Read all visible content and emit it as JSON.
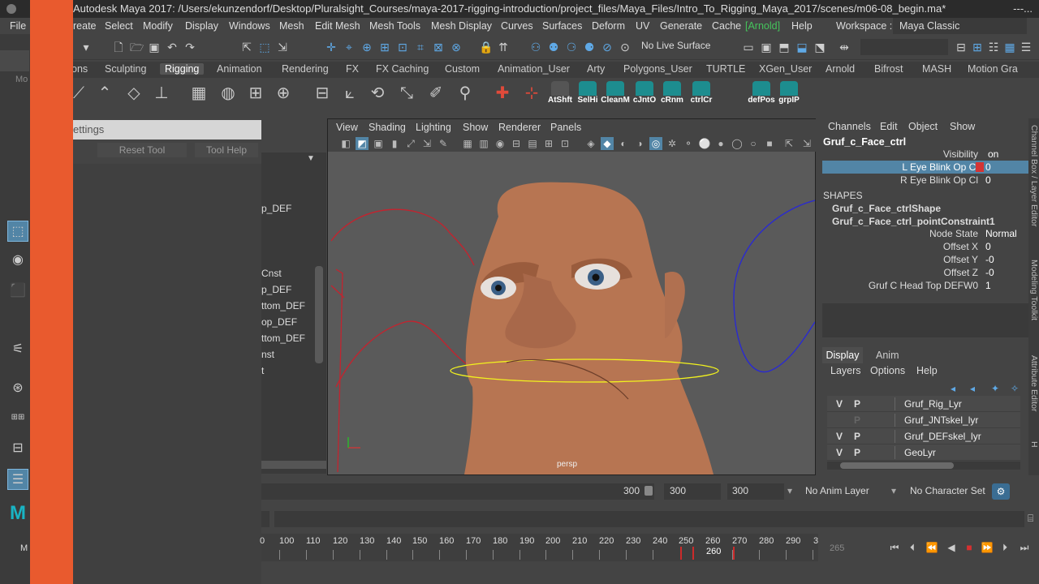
{
  "window": {
    "title": "Autodesk Maya 2017: /Users/ekunzendorf/Desktop/Pluralsight_Courses/maya-2017-rigging-introduction/project_files/Maya_Files/Intro_To_Rigging_Maya_2017/scenes/m06-08_begin.ma*",
    "title_suffix": "---..."
  },
  "menubar": {
    "items": [
      "File",
      "reate",
      "Select",
      "Modify",
      "Display",
      "Windows",
      "Mesh",
      "Edit Mesh",
      "Mesh Tools",
      "Mesh Display",
      "Curves",
      "Surfaces",
      "Deform",
      "UV",
      "Generate",
      "Cache",
      "[Arnold]",
      "Help"
    ],
    "workspace_label": "Workspace :",
    "workspace_value": "Maya Classic"
  },
  "statusline": {
    "live_surface": "No Live Surface",
    "left_mode": "Mo"
  },
  "shelf": {
    "tabs": [
      "ons",
      "Sculpting",
      "Rigging",
      "Animation",
      "Rendering",
      "FX",
      "FX Caching",
      "Custom",
      "Animation_User",
      "Arty",
      "Polygons_User",
      "TURTLE",
      "XGen_User",
      "Arnold",
      "Bifrost",
      "MASH",
      "Motion Gra"
    ],
    "custom_buttons": [
      "AtShft",
      "SelHi",
      "CleanM",
      "cJntO",
      "cRnm",
      "ctrlCr",
      "defPos",
      "grpIP"
    ]
  },
  "tool_settings": {
    "title": "ettings",
    "reset_label": "Reset Tool",
    "help_label": "Tool Help"
  },
  "outliner": {
    "items": [
      "p_DEF",
      "Cnst",
      "p_DEF",
      "ttom_DEF",
      "op_DEF",
      "ttom_DEF",
      "nst",
      "t"
    ]
  },
  "viewport": {
    "menu": [
      "View",
      "Shading",
      "Lighting",
      "Show",
      "Renderer",
      "Panels"
    ],
    "camera_label": "persp"
  },
  "channel_box": {
    "menu": [
      "Channels",
      "Edit",
      "Object",
      "Show"
    ],
    "node_name": "Gruf_c_Face_ctrl",
    "attributes": [
      {
        "name": "Visibility",
        "value": "on"
      },
      {
        "name": "L Eye Blink Op Cl",
        "value": "0"
      },
      {
        "name": "R Eye Blink Op Cl",
        "value": "0"
      }
    ],
    "shapes_header": "SHAPES",
    "shapes": [
      "Gruf_c_Face_ctrlShape",
      "Gruf_c_Face_ctrl_pointConstraint1"
    ],
    "shape_attributes": [
      {
        "name": "Node State",
        "value": "Normal"
      },
      {
        "name": "Offset X",
        "value": "0"
      },
      {
        "name": "Offset Y",
        "value": "-0"
      },
      {
        "name": "Offset Z",
        "value": "-0"
      },
      {
        "name": "Gruf C Head Top DEFW0",
        "value": "1"
      }
    ]
  },
  "right_tabs": [
    "Channel Box / Layer Editor",
    "Modeling Toolkit",
    "Attribute Editor",
    "H"
  ],
  "layer_editor": {
    "tabs": [
      "Display",
      "Anim"
    ],
    "menu": [
      "Layers",
      "Options",
      "Help"
    ],
    "layers": [
      {
        "v": "V",
        "p": "P",
        "name": "Gruf_Rig_Lyr"
      },
      {
        "v": "",
        "p": "P",
        "name": "Gruf_JNTskel_lyr"
      },
      {
        "v": "V",
        "p": "P",
        "name": "Gruf_DEFskel_lyr"
      },
      {
        "v": "V",
        "p": "P",
        "name": "GeoLyr"
      }
    ]
  },
  "range_bar": {
    "end_value": "300",
    "range_end": "300",
    "range_end2": "300",
    "anim_layer": "No Anim Layer",
    "character_set": "No Character Set"
  },
  "time_slider": {
    "tick_labels": [
      "0",
      "100",
      "110",
      "120",
      "130",
      "140",
      "150",
      "160",
      "170",
      "180",
      "190",
      "200",
      "210",
      "220",
      "230",
      "240",
      "250",
      "260",
      "270",
      "280",
      "290",
      "3"
    ],
    "current_frame": "260",
    "frame_field": "265"
  },
  "colors": {
    "accent_orange": "#e95a2e",
    "selection_blue": "#5285a6",
    "arnold_green": "#45c45c",
    "key_red": "#cc2b2b"
  },
  "bottom_left_label": "M"
}
